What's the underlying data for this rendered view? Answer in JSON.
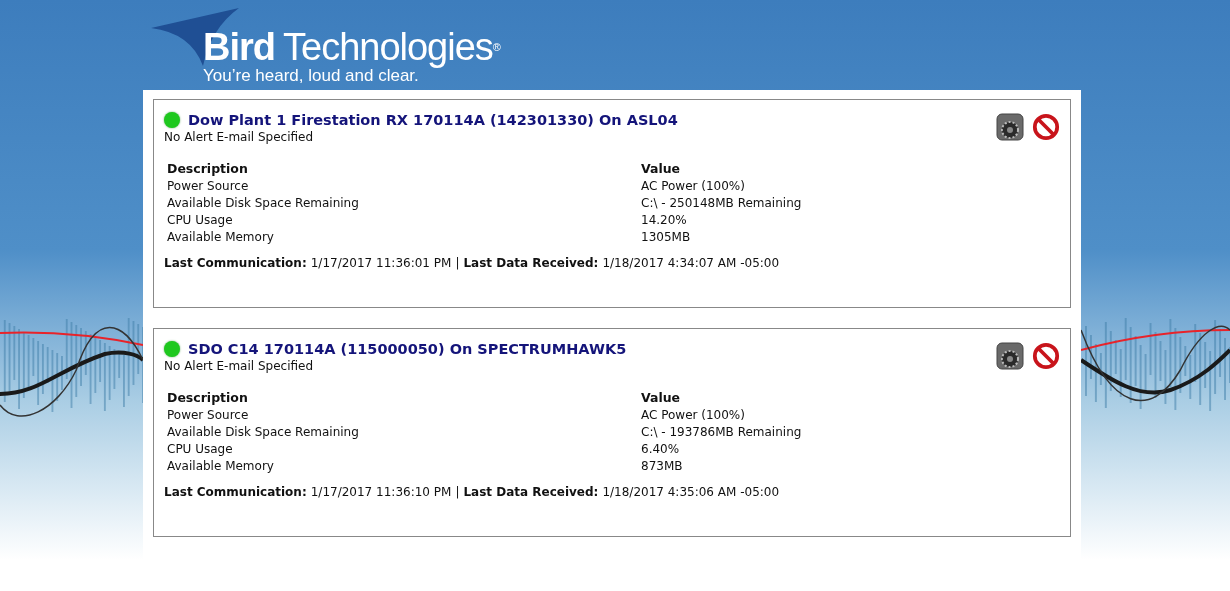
{
  "logo": {
    "name_bold": "Bird",
    "name_light": "Technologies",
    "mark": "®",
    "tagline": "You’re heard, loud and clear."
  },
  "devices": [
    {
      "color": "#1ec81e",
      "title": "Dow Plant 1 Firestation RX 170114A (142301330) On ASL04",
      "alert": "No Alert E-mail Specified",
      "columns": [
        "Description",
        "Value"
      ],
      "rows": [
        [
          "Power Source",
          "AC Power (100%)"
        ],
        [
          "Available Disk Space Remaining",
          "C:\\ - 250148MB Remaining"
        ],
        [
          "CPU Usage",
          "14.20%"
        ],
        [
          "Available Memory",
          "1305MB"
        ]
      ],
      "last_comm_label": "Last Communication:",
      "last_comm": "1/17/2017 11:36:01 PM",
      "sep": "|",
      "last_data_label": "Last Data Received:",
      "last_data": "1/18/2017 4:34:07 AM -05:00"
    },
    {
      "color": "#1ec81e",
      "title": "SDO C14 170114A (115000050) On SPECTRUMHAWK5",
      "alert": "No Alert E-mail Specified",
      "columns": [
        "Description",
        "Value"
      ],
      "rows": [
        [
          "Power Source",
          "AC Power (100%)"
        ],
        [
          "Available Disk Space Remaining",
          "C:\\ - 193786MB Remaining"
        ],
        [
          "CPU Usage",
          "6.40%"
        ],
        [
          "Available Memory",
          "873MB"
        ]
      ],
      "last_comm_label": "Last Communication:",
      "last_comm": "1/17/2017 11:36:10 PM",
      "sep": "|",
      "last_data_label": "Last Data Received:",
      "last_data": "1/18/2017 4:35:06 AM -05:00"
    }
  ]
}
